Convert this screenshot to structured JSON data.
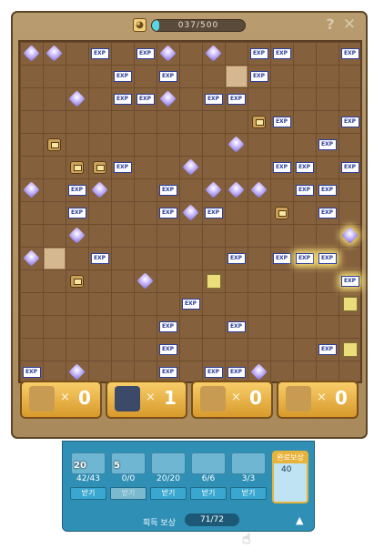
{
  "header": {
    "progress_text": "037/500",
    "progress_value": 0.074,
    "help_label": "?",
    "close_label": "✕",
    "cat_icon": "cat-icon"
  },
  "board": {
    "items": [
      {
        "t": "gem",
        "c": 0,
        "r": 0
      },
      {
        "t": "gem",
        "c": 1,
        "r": 0
      },
      {
        "t": "exp",
        "c": 3,
        "r": 0
      },
      {
        "t": "exp",
        "c": 5,
        "r": 0
      },
      {
        "t": "gem",
        "c": 6,
        "r": 0
      },
      {
        "t": "gem",
        "c": 8,
        "r": 0
      },
      {
        "t": "exp",
        "c": 10,
        "r": 0
      },
      {
        "t": "exp",
        "c": 11,
        "r": 0
      },
      {
        "t": "exp",
        "c": 14,
        "r": 0
      },
      {
        "t": "exp",
        "c": 4,
        "r": 1
      },
      {
        "t": "exp",
        "c": 6,
        "r": 1
      },
      {
        "t": "tile",
        "c": 9,
        "r": 1
      },
      {
        "t": "exp",
        "c": 10,
        "r": 1
      },
      {
        "t": "gem",
        "c": 2,
        "r": 2
      },
      {
        "t": "exp",
        "c": 4,
        "r": 2
      },
      {
        "t": "exp",
        "c": 5,
        "r": 2
      },
      {
        "t": "gem",
        "c": 6,
        "r": 2
      },
      {
        "t": "exp",
        "c": 8,
        "r": 2
      },
      {
        "t": "exp",
        "c": 9,
        "r": 2
      },
      {
        "t": "chest",
        "c": 10,
        "r": 3
      },
      {
        "t": "exp",
        "c": 11,
        "r": 3
      },
      {
        "t": "exp",
        "c": 14,
        "r": 3
      },
      {
        "t": "chest",
        "c": 1,
        "r": 4
      },
      {
        "t": "gem",
        "c": 9,
        "r": 4
      },
      {
        "t": "exp",
        "c": 13,
        "r": 4
      },
      {
        "t": "chest",
        "c": 2,
        "r": 5
      },
      {
        "t": "chest",
        "c": 3,
        "r": 5
      },
      {
        "t": "exp",
        "c": 4,
        "r": 5
      },
      {
        "t": "gem",
        "c": 7,
        "r": 5
      },
      {
        "t": "exp",
        "c": 11,
        "r": 5
      },
      {
        "t": "exp",
        "c": 12,
        "r": 5
      },
      {
        "t": "exp",
        "c": 14,
        "r": 5
      },
      {
        "t": "gem",
        "c": 0,
        "r": 6
      },
      {
        "t": "exp",
        "c": 2,
        "r": 6
      },
      {
        "t": "gem",
        "c": 3,
        "r": 6
      },
      {
        "t": "exp",
        "c": 6,
        "r": 6
      },
      {
        "t": "gem",
        "c": 8,
        "r": 6
      },
      {
        "t": "gem",
        "c": 9,
        "r": 6
      },
      {
        "t": "gem",
        "c": 10,
        "r": 6
      },
      {
        "t": "exp",
        "c": 12,
        "r": 6
      },
      {
        "t": "exp",
        "c": 13,
        "r": 6
      },
      {
        "t": "exp",
        "c": 2,
        "r": 7
      },
      {
        "t": "exp",
        "c": 6,
        "r": 7
      },
      {
        "t": "gem",
        "c": 7,
        "r": 7
      },
      {
        "t": "exp",
        "c": 8,
        "r": 7
      },
      {
        "t": "chest",
        "c": 11,
        "r": 7
      },
      {
        "t": "exp",
        "c": 13,
        "r": 7
      },
      {
        "t": "gem",
        "c": 2,
        "r": 8
      },
      {
        "t": "gem",
        "c": 14,
        "r": 8,
        "g": true
      },
      {
        "t": "gem",
        "c": 0,
        "r": 9
      },
      {
        "t": "tile",
        "c": 1,
        "r": 9
      },
      {
        "t": "exp",
        "c": 3,
        "r": 9
      },
      {
        "t": "exp",
        "c": 9,
        "r": 9
      },
      {
        "t": "exp",
        "c": 11,
        "r": 9
      },
      {
        "t": "exp",
        "c": 12,
        "r": 9,
        "g": true
      },
      {
        "t": "exp",
        "c": 13,
        "r": 9,
        "g": true
      },
      {
        "t": "chest",
        "c": 2,
        "r": 10
      },
      {
        "t": "gem",
        "c": 5,
        "r": 10
      },
      {
        "t": "cube",
        "c": 8,
        "r": 10
      },
      {
        "t": "exp",
        "c": 14,
        "r": 10,
        "g": true
      },
      {
        "t": "exp",
        "c": 7,
        "r": 11
      },
      {
        "t": "cube",
        "c": 14,
        "r": 11
      },
      {
        "t": "exp",
        "c": 6,
        "r": 12
      },
      {
        "t": "exp",
        "c": 9,
        "r": 12
      },
      {
        "t": "exp",
        "c": 6,
        "r": 13
      },
      {
        "t": "exp",
        "c": 13,
        "r": 13
      },
      {
        "t": "cube",
        "c": 14,
        "r": 13
      },
      {
        "t": "exp",
        "c": 0,
        "r": 14
      },
      {
        "t": "gem",
        "c": 2,
        "r": 14
      },
      {
        "t": "exp",
        "c": 6,
        "r": 14
      },
      {
        "t": "exp",
        "c": 8,
        "r": 14
      },
      {
        "t": "exp",
        "c": 9,
        "r": 14
      },
      {
        "t": "gem",
        "c": 10,
        "r": 14
      }
    ],
    "exp_label": "EXP"
  },
  "resources": [
    {
      "icon": "scroll-icon",
      "x": "×",
      "count": "0",
      "color": "#c79b52"
    },
    {
      "icon": "bomb-icon",
      "x": "×",
      "count": "1",
      "color": "#3c4a6a"
    },
    {
      "icon": "chain-icon",
      "x": "×",
      "count": "0",
      "color": "#c79b52"
    },
    {
      "icon": "tower-icon",
      "x": "×",
      "count": "0",
      "color": "#c79b52"
    }
  ],
  "rewards": {
    "slots": [
      {
        "icon": "exp-card-icon",
        "badge": "20",
        "count": "42/43",
        "btn": "받기",
        "enabled": true
      },
      {
        "icon": "gem-pile-icon",
        "badge": "5",
        "count": "0/0",
        "btn": "받기",
        "enabled": false
      },
      {
        "icon": "gem-icon",
        "badge": "",
        "count": "20/20",
        "btn": "받기",
        "enabled": true
      },
      {
        "icon": "chest-icon",
        "badge": "",
        "count": "6/6",
        "btn": "받기",
        "enabled": true
      },
      {
        "icon": "cube-icon",
        "badge": "",
        "count": "3/3",
        "btn": "받기",
        "enabled": true
      }
    ],
    "completion_label": "완료보상",
    "completion_count": "40",
    "total_label": "획득 보상",
    "total_value": "71/72",
    "collapse_icon": "chevron-up-icon"
  }
}
